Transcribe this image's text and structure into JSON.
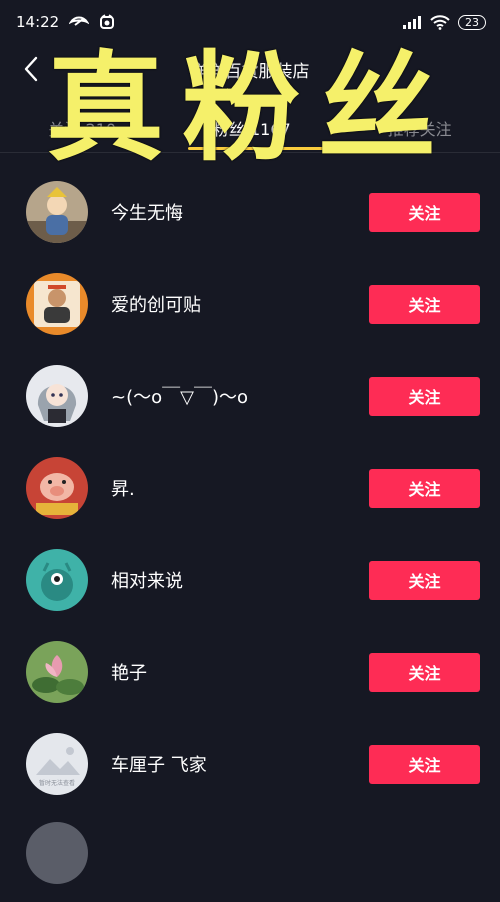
{
  "status_bar": {
    "time": "14:22",
    "battery": "23",
    "icons": [
      "notification-icon",
      "app-icon",
      "signal-icon",
      "wifi-icon",
      "battery-icon"
    ]
  },
  "header": {
    "title": "洋洋百货服装店",
    "back_icon": "chevron-left-icon"
  },
  "tabs": [
    {
      "label": "关注 210"
    },
    {
      "label": "粉丝 1167"
    },
    {
      "label": "推荐关注"
    }
  ],
  "active_tab_index": 1,
  "overlay_text": "真粉丝",
  "follow_label": "关注",
  "followers": [
    {
      "name": "今生无悔",
      "avatar_color": "#8c7a63"
    },
    {
      "name": "爱的创可贴",
      "avatar_color": "#e98a2a"
    },
    {
      "name": "~(〜o￣▽￣)〜o",
      "avatar_color": "#c9ccd2"
    },
    {
      "name": "昇.",
      "avatar_color": "#c74436"
    },
    {
      "name": "相对来说",
      "avatar_color": "#3fb2a8"
    },
    {
      "name": "艳子",
      "avatar_color": "#5c8c4a"
    },
    {
      "name": "车厘子 飞家",
      "avatar_color": "#e4e7ec",
      "avatar_text": "暂时无法查看"
    }
  ],
  "colors": {
    "background": "#161823",
    "follow_button": "#fe2c55",
    "tab_indicator": "#facd3e",
    "overlay_text": "#f5f06a"
  }
}
